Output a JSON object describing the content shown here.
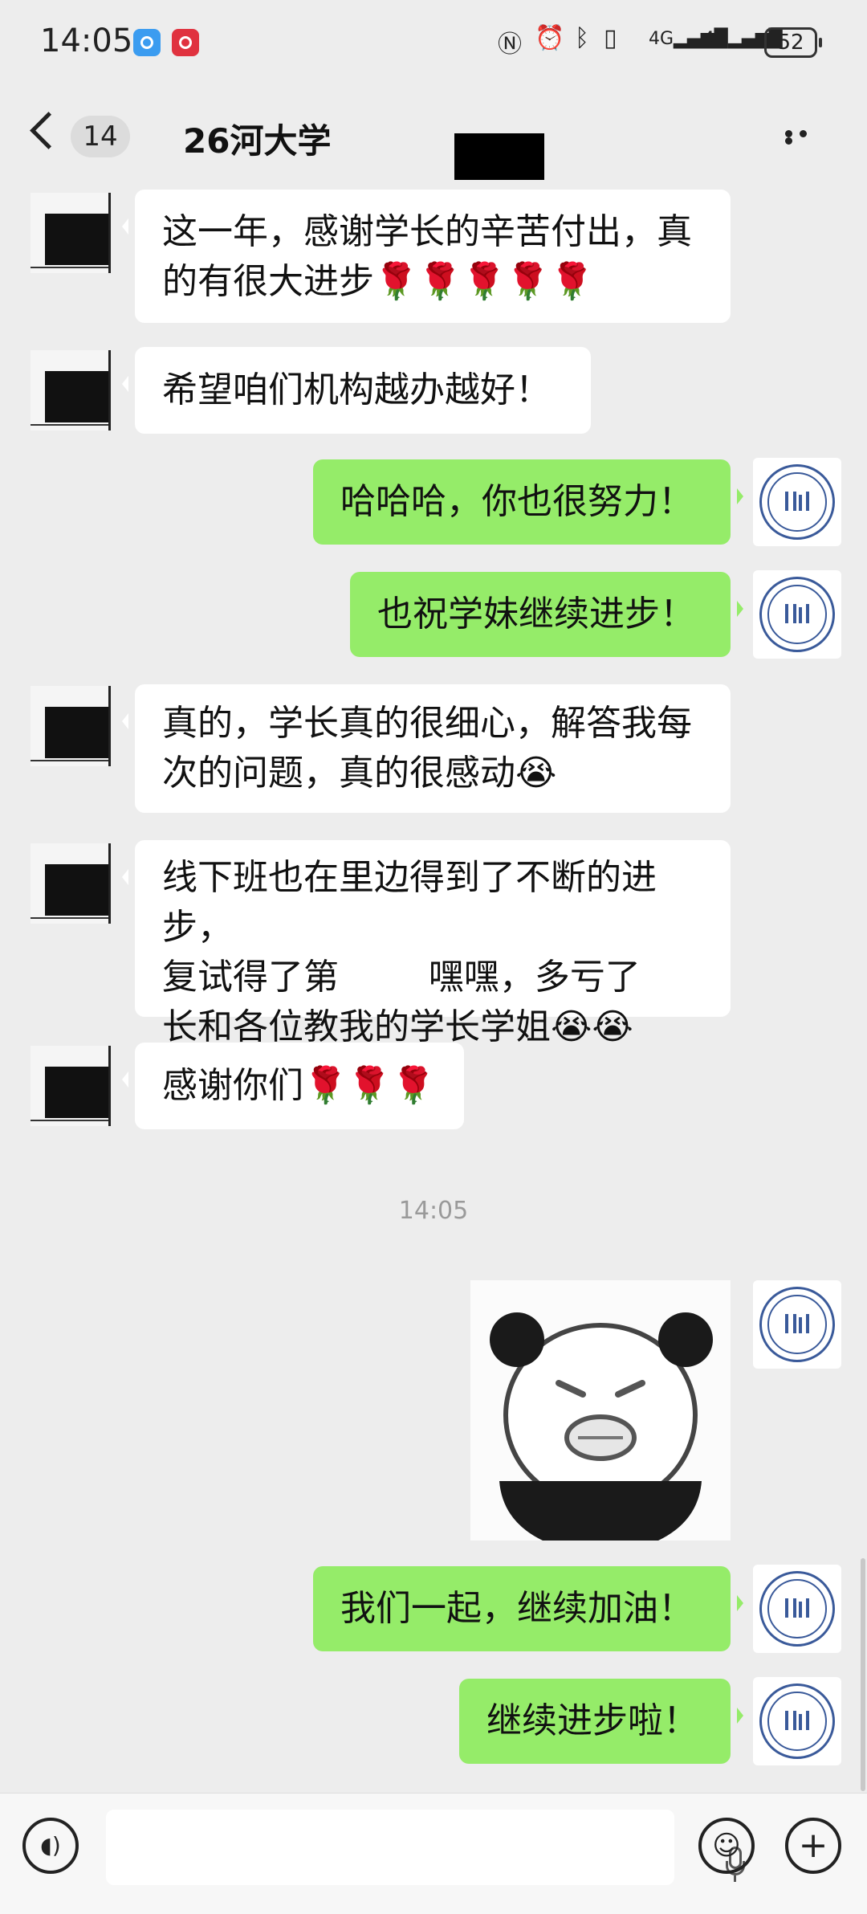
{
  "status_bar": {
    "time": "14:05",
    "icons": [
      "app-icon-blue",
      "app-icon-red",
      "nfc-icon",
      "alarm-icon",
      "bluetooth-icon",
      "vibrate-icon",
      "4g-signal-icon",
      "4g-signal-icon"
    ],
    "battery": "52"
  },
  "header": {
    "back_count": "14",
    "title": "26河大学"
  },
  "messages": [
    {
      "side": "left",
      "text": "这一年，感谢学长的辛苦付出，真\n的有很大进步🌹🌹🌹🌹🌹"
    },
    {
      "side": "left",
      "text": "希望咱们机构越办越好！"
    },
    {
      "side": "right",
      "text": "哈哈哈，你也很努力！"
    },
    {
      "side": "right",
      "text": "也祝学妹继续进步！"
    },
    {
      "side": "left",
      "text": "真的，学长真的很细心，解答我每\n次的问题，真的很感动😭"
    },
    {
      "side": "left",
      "text": "线下班也在里边得到了不断的进步，\n复试得了第        嘿嘿，多亏了\n长和各位教我的学长学姐😭😭"
    },
    {
      "side": "left",
      "text": "感谢你们🌹🌹🌹"
    },
    {
      "side": "right",
      "text": "我们一起，继续加油！"
    },
    {
      "side": "right",
      "text": "继续进步啦！"
    }
  ],
  "timestamp": "14:05",
  "colors": {
    "background": "#ededed",
    "bubble_self": "#95ec69",
    "bubble_other": "#ffffff"
  },
  "input_bar": {
    "voice_icon": "voice-icon",
    "mic_icon": "microphone-icon",
    "emoji_icon": "emoji-icon",
    "plus_icon": "plus-icon"
  }
}
